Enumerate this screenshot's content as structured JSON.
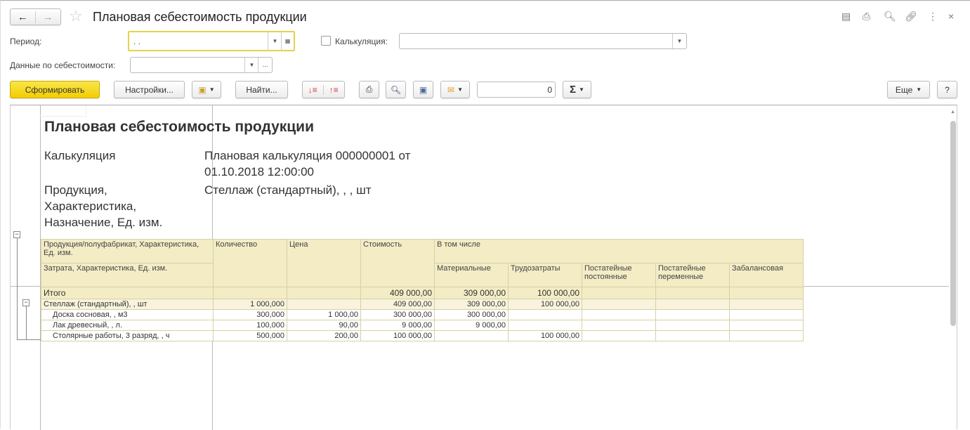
{
  "header": {
    "title": "Плановая себестоимость продукции"
  },
  "filters": {
    "period_label": "Период:",
    "period_value": " .  .",
    "calc_checkbox_label": "Калькуляция:",
    "calc_value": "",
    "cost_data_label": "Данные по себестоимости:",
    "cost_data_value": "",
    "more": "..."
  },
  "toolbar": {
    "generate": "Сформировать",
    "settings": "Настройки...",
    "find": "Найти...",
    "sum_value": "0",
    "sigma": "Σ",
    "more": "Еще",
    "help": "?"
  },
  "report": {
    "title": "Плановая себестоимость продукции",
    "calc_label": "Калькуляция",
    "calc_value_1": "Плановая калькуляция 000000001 от",
    "calc_value_2": "01.10.2018 12:00:00",
    "prod_label_1": "Продукция,",
    "prod_label_2": "Характеристика,",
    "prod_label_3": "Назначение, Ед. изм.",
    "prod_value": "Стеллаж (стандартный), , , шт",
    "columns": {
      "product": "Продукция/полуфабрикат, Характеристика, Ед. изм.",
      "cost_item": "Затрата, Характеристика, Ед. изм.",
      "qty": "Количество",
      "price": "Цена",
      "cost": "Стоимость",
      "incl": "В том числе",
      "mat": "Материальные",
      "labor": "Трудозатраты",
      "fixed": "Постатейные постоянные",
      "variable": "Постатейные переменные",
      "offbal": "Забалансовая"
    },
    "rows": [
      {
        "type": "tot",
        "cells": [
          "Итого",
          "",
          "",
          "409 000,00",
          "309 000,00",
          "100 000,00",
          "",
          "",
          ""
        ]
      },
      {
        "type": "grp",
        "cells": [
          "Стеллаж (стандартный), , шт",
          "1 000,000",
          "",
          "409 000,00",
          "309 000,00",
          "100 000,00",
          "",
          "",
          ""
        ]
      },
      {
        "type": "det",
        "cells": [
          "Доска сосновая, , м3",
          "300,000",
          "1 000,00",
          "300 000,00",
          "300 000,00",
          "",
          "",
          "",
          ""
        ]
      },
      {
        "type": "det",
        "cells": [
          "Лак древесный, , л.",
          "100,000",
          "90,00",
          "9 000,00",
          "9 000,00",
          "",
          "",
          "",
          ""
        ]
      },
      {
        "type": "det",
        "cells": [
          "Столярные работы, 3 разряд, , ч",
          "500,000",
          "200,00",
          "100 000,00",
          "",
          "100 000,00",
          "",
          "",
          ""
        ]
      }
    ]
  }
}
